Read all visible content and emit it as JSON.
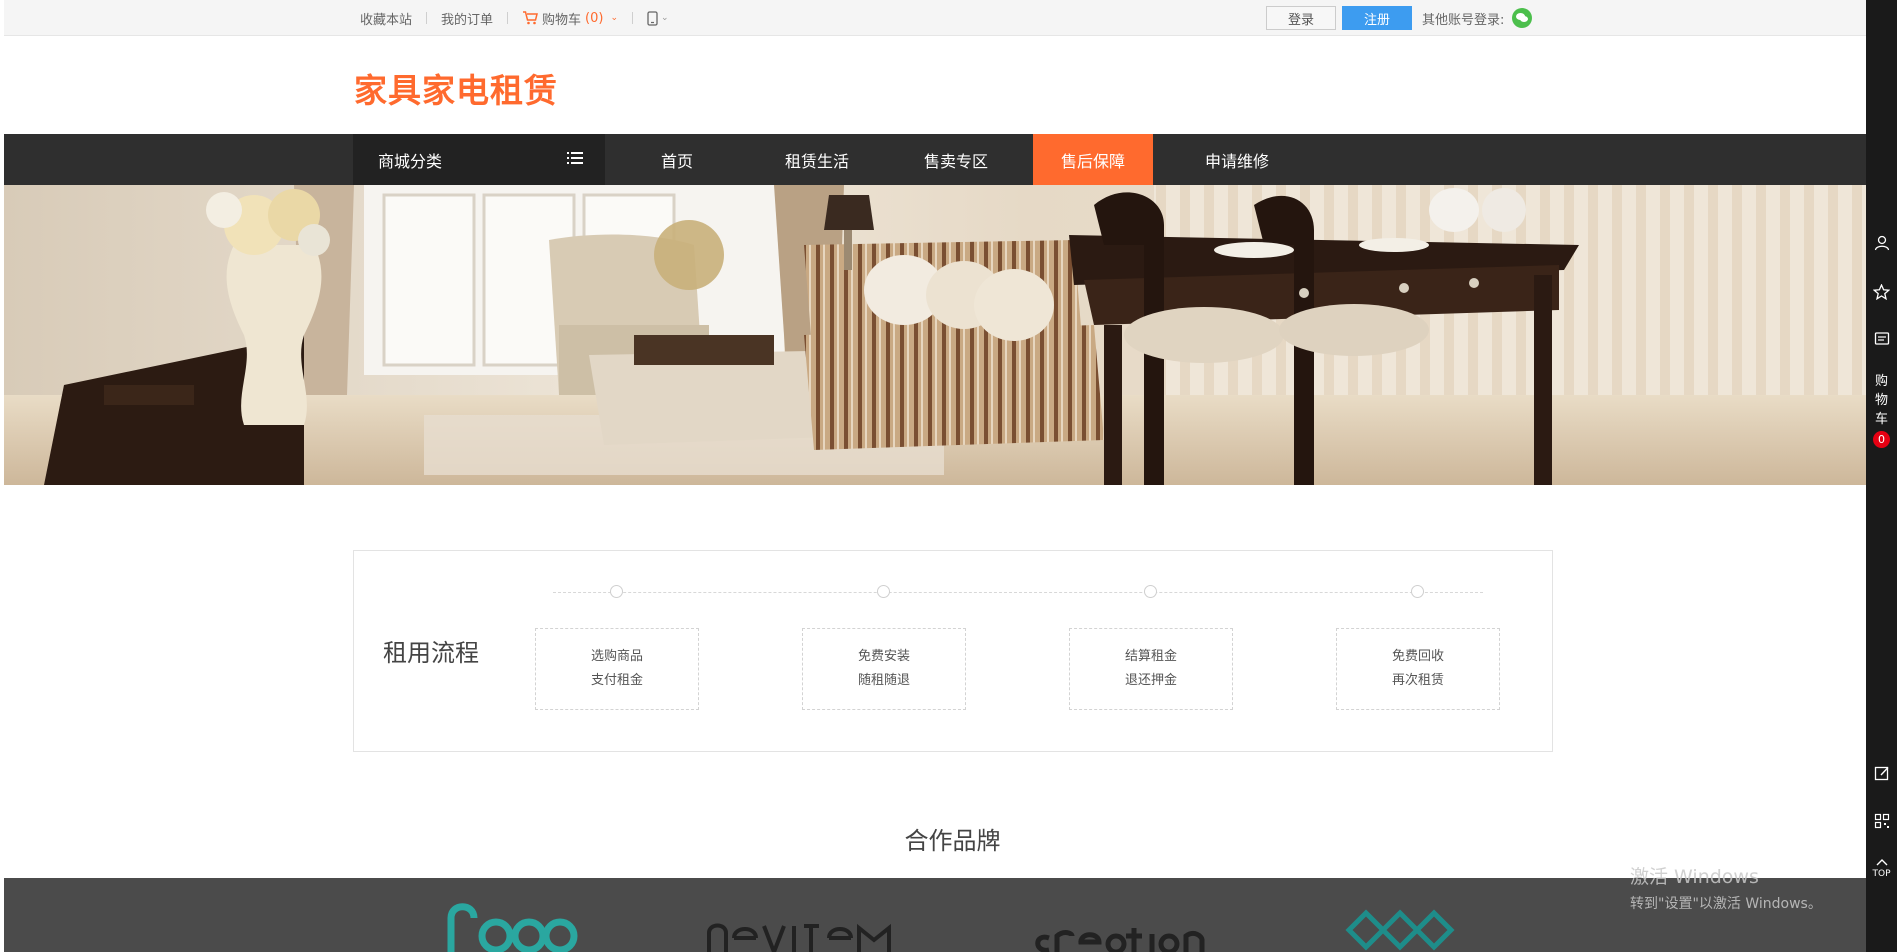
{
  "topbar": {
    "bookmark": "收藏本站",
    "orders": "我的订单",
    "cart_label": "购物车",
    "cart_count": "(0)",
    "login": "登录",
    "register": "注册",
    "other_login": "其他账号登录:"
  },
  "header": {
    "logo": "家具家电租赁"
  },
  "nav": {
    "category": "商城分类",
    "items": [
      "首页",
      "租赁生活",
      "售卖专区",
      "售后保障",
      "申请维修"
    ],
    "active_index": 3
  },
  "process": {
    "title": "租用流程",
    "steps": [
      {
        "line1": "选购商品",
        "line2": "支付租金"
      },
      {
        "line1": "免费安装",
        "line2": "随租随退"
      },
      {
        "line1": "结算租金",
        "line2": "退还押金"
      },
      {
        "line1": "免费回收",
        "line2": "再次租赁"
      }
    ]
  },
  "brands": {
    "title": "合作品牌"
  },
  "right_toolbar": {
    "cart_chars": [
      "购",
      "物",
      "车"
    ],
    "cart_badge": "0",
    "top_label": "TOP"
  },
  "watermark": {
    "line1": "激活 Windows",
    "line2": "转到\"设置\"以激活 Windows。"
  },
  "colors": {
    "accent": "#ff6a2e",
    "register_blue": "#3d9cf0",
    "nav_bg": "#2f2f2f",
    "category_bg": "#222222",
    "badge_red": "#e60012",
    "toolbar_bg": "#1a1a1a"
  }
}
